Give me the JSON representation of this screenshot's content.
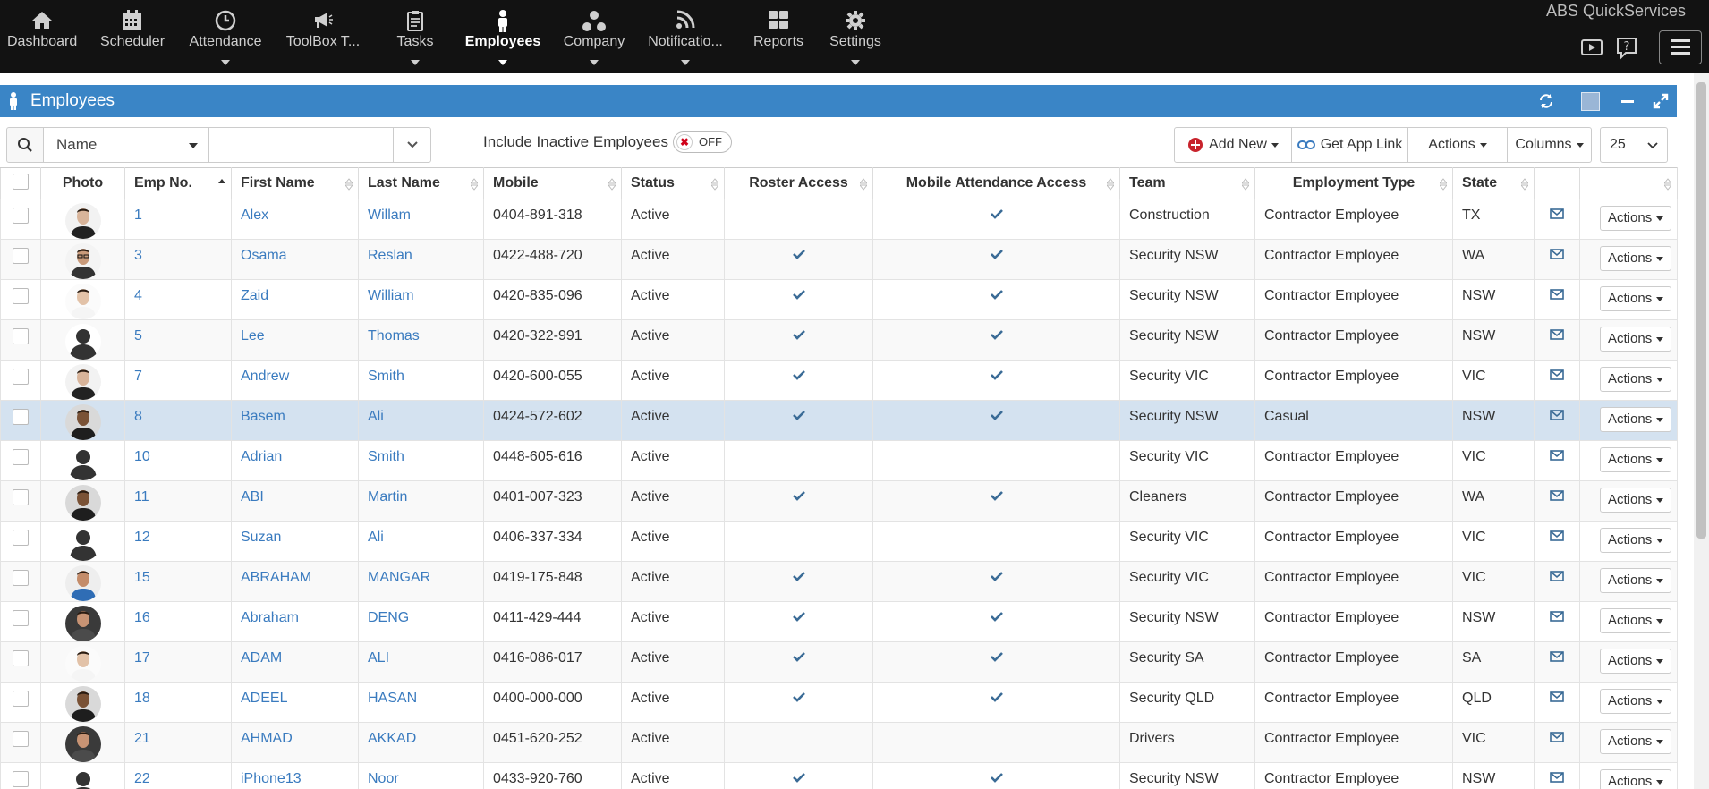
{
  "app": {
    "brand": "ABS QuickServices"
  },
  "nav": [
    {
      "label": "Dashboard",
      "icon": "home-icon",
      "caret": false
    },
    {
      "label": "Scheduler",
      "icon": "calendar-icon",
      "caret": false
    },
    {
      "label": "Attendance",
      "icon": "clock-icon",
      "caret": true
    },
    {
      "label": "ToolBox T...",
      "icon": "megaphone-icon",
      "caret": false
    },
    {
      "label": "Tasks",
      "icon": "clipboard-icon",
      "caret": true
    },
    {
      "label": "Employees",
      "icon": "person-icon",
      "caret": true,
      "active": true
    },
    {
      "label": "Company",
      "icon": "sitemap-icon",
      "caret": true
    },
    {
      "label": "Notificatio...",
      "icon": "rss-icon",
      "caret": true
    },
    {
      "label": "Reports",
      "icon": "grid-icon",
      "caret": false
    },
    {
      "label": "Settings",
      "icon": "gear-icon",
      "caret": true
    }
  ],
  "panel": {
    "title": "Employees"
  },
  "toolbar": {
    "search_field": "Name",
    "search_value": "",
    "include_inactive_label": "Include Inactive Employees",
    "toggle_text": "OFF",
    "add_new": "Add New",
    "get_app_link": "Get App Link",
    "actions": "Actions",
    "columns": "Columns",
    "page_size": "25"
  },
  "columns": [
    "",
    "Photo",
    "Emp No.",
    "First Name",
    "Last Name",
    "Mobile",
    "Status",
    "Roster Access",
    "Mobile Attendance Access",
    "Team",
    "Employment Type",
    "State",
    "",
    ""
  ],
  "row_action_label": "Actions",
  "rows": [
    {
      "emp": "1",
      "first": "Alex",
      "last": "Willam",
      "mobile": "0404-891-318",
      "status": "Active",
      "roster": false,
      "mobile_att": true,
      "team": "Construction",
      "type": "Contractor Employee",
      "state": "TX",
      "photo": "suit"
    },
    {
      "emp": "3",
      "first": "Osama",
      "last": "Reslan",
      "mobile": "0422-488-720",
      "status": "Active",
      "roster": true,
      "mobile_att": true,
      "team": "Security NSW",
      "type": "Contractor Employee",
      "state": "WA",
      "photo": "glasses"
    },
    {
      "emp": "4",
      "first": "Zaid",
      "last": "William",
      "mobile": "0420-835-096",
      "status": "Active",
      "roster": true,
      "mobile_att": true,
      "team": "Security NSW",
      "type": "Contractor Employee",
      "state": "NSW",
      "photo": "white"
    },
    {
      "emp": "5",
      "first": "Lee",
      "last": "Thomas",
      "mobile": "0420-322-991",
      "status": "Active",
      "roster": true,
      "mobile_att": true,
      "team": "Security NSW",
      "type": "Contractor Employee",
      "state": "NSW",
      "photo": "none"
    },
    {
      "emp": "7",
      "first": "Andrew",
      "last": "Smith",
      "mobile": "0420-600-055",
      "status": "Active",
      "roster": true,
      "mobile_att": true,
      "team": "Security VIC",
      "type": "Contractor Employee",
      "state": "VIC",
      "photo": "suit"
    },
    {
      "emp": "8",
      "first": "Basem",
      "last": "Ali",
      "mobile": "0424-572-602",
      "status": "Active",
      "roster": true,
      "mobile_att": true,
      "team": "Security NSW",
      "type": "Casual",
      "state": "NSW",
      "photo": "dark",
      "highlight": true
    },
    {
      "emp": "10",
      "first": "Adrian",
      "last": "Smith",
      "mobile": "0448-605-616",
      "status": "Active",
      "roster": false,
      "mobile_att": false,
      "team": "Security VIC",
      "type": "Contractor Employee",
      "state": "VIC",
      "photo": "none"
    },
    {
      "emp": "11",
      "first": "ABI",
      "last": "Martin",
      "mobile": "0401-007-323",
      "status": "Active",
      "roster": true,
      "mobile_att": true,
      "team": "Cleaners",
      "type": "Contractor Employee",
      "state": "WA",
      "photo": "dark"
    },
    {
      "emp": "12",
      "first": "Suzan",
      "last": "Ali",
      "mobile": "0406-337-334",
      "status": "Active",
      "roster": false,
      "mobile_att": false,
      "team": "Security VIC",
      "type": "Contractor Employee",
      "state": "VIC",
      "photo": "none"
    },
    {
      "emp": "15",
      "first": "ABRAHAM",
      "last": "MANGAR",
      "mobile": "0419-175-848",
      "status": "Active",
      "roster": true,
      "mobile_att": true,
      "team": "Security VIC",
      "type": "Contractor Employee",
      "state": "VIC",
      "photo": "blue"
    },
    {
      "emp": "16",
      "first": "Abraham",
      "last": "DENG",
      "mobile": "0411-429-444",
      "status": "Active",
      "roster": true,
      "mobile_att": true,
      "team": "Security NSW",
      "type": "Contractor Employee",
      "state": "NSW",
      "photo": "face"
    },
    {
      "emp": "17",
      "first": "ADAM",
      "last": "ALI",
      "mobile": "0416-086-017",
      "status": "Active",
      "roster": true,
      "mobile_att": true,
      "team": "Security SA",
      "type": "Contractor Employee",
      "state": "SA",
      "photo": "white"
    },
    {
      "emp": "18",
      "first": "ADEEL",
      "last": "HASAN",
      "mobile": "0400-000-000",
      "status": "Active",
      "roster": true,
      "mobile_att": true,
      "team": "Security QLD",
      "type": "Contractor Employee",
      "state": "QLD",
      "photo": "dark"
    },
    {
      "emp": "21",
      "first": "AHMAD",
      "last": "AKKAD",
      "mobile": "0451-620-252",
      "status": "Active",
      "roster": false,
      "mobile_att": false,
      "team": "Drivers",
      "type": "Contractor Employee",
      "state": "VIC",
      "photo": "face"
    },
    {
      "emp": "22",
      "first": "iPhone13",
      "last": "Noor",
      "mobile": "0433-920-760",
      "status": "Active",
      "roster": true,
      "mobile_att": true,
      "team": "Security NSW",
      "type": "Contractor Employee",
      "state": "NSW",
      "photo": "none"
    }
  ]
}
